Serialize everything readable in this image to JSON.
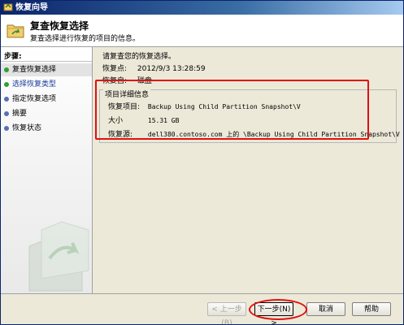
{
  "window": {
    "title": "恢复向导"
  },
  "header": {
    "title": "复查恢复选择",
    "subtitle": "复查选择进行恢复的项目的信息。"
  },
  "sidebar": {
    "heading": "步骤:",
    "items": [
      {
        "label": "复查恢复选择",
        "state": "current"
      },
      {
        "label": "选择恢复类型",
        "state": "link"
      },
      {
        "label": "指定恢复选项",
        "state": "pending"
      },
      {
        "label": "摘要",
        "state": "pending"
      },
      {
        "label": "恢复状态",
        "state": "pending"
      }
    ]
  },
  "main": {
    "intro": "请复查您的恢复选择。",
    "recovery_point_label": "恢复点:",
    "recovery_point_value": "2012/9/3 13:28:59",
    "recover_from_label": "恢复自:",
    "recover_from_value": "磁盘",
    "details": {
      "title": "项目详细信息",
      "item_label": "恢复项目:",
      "item_value": "Backup Using Child Partition Snapshot\\V",
      "size_label": "大小",
      "size_value": "15.31 GB",
      "source_label": "恢复源:",
      "source_value": "dell380.contoso.com 上的 \\Backup Using Child Partition Snapshot\\V"
    }
  },
  "footer": {
    "back": "< 上一步(B)",
    "next": "下一步(N) >",
    "cancel": "取消",
    "help": "帮助"
  },
  "colors": {
    "titlebar": "#0a246a",
    "highlight": "#e01010",
    "step_done": "#2fa02f",
    "step_pending": "#5a6fb0"
  }
}
